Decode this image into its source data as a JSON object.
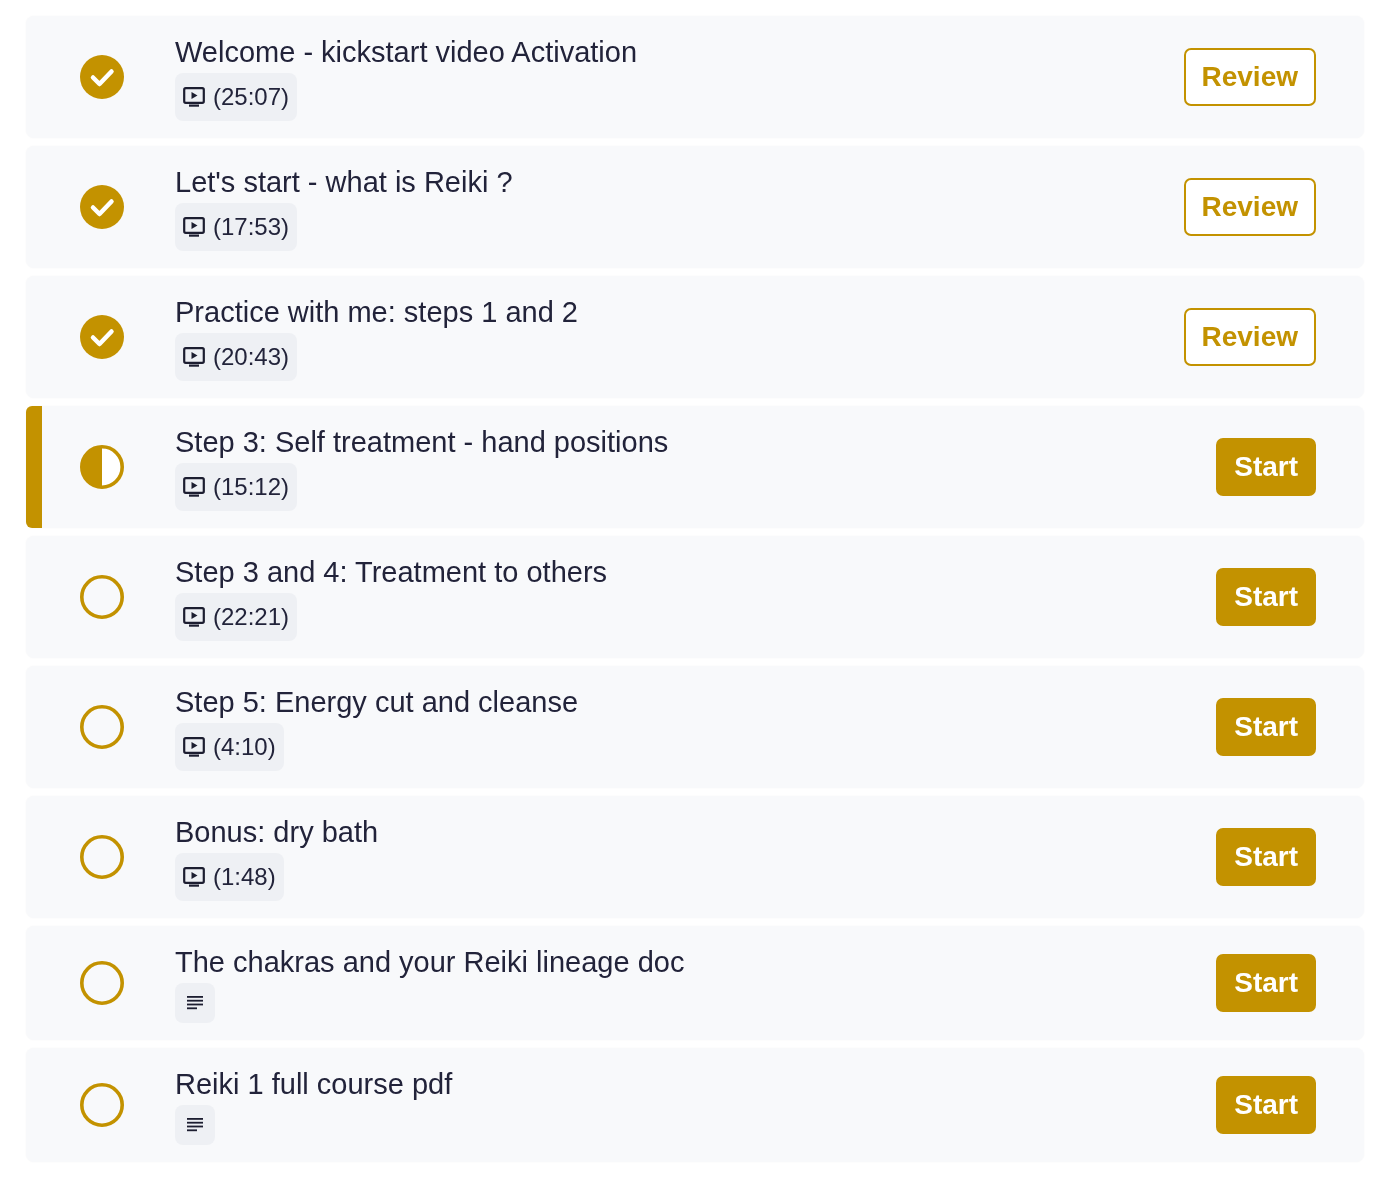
{
  "lessons": [
    {
      "title": "Welcome - kickstart video Activation",
      "kind": "complete",
      "selected": false,
      "media": {
        "kind": "video",
        "duration": "(25:07)"
      },
      "action": {
        "label": "Review",
        "kind": "outline"
      }
    },
    {
      "title": "Let's start - what is Reiki ?",
      "kind": "complete",
      "selected": false,
      "media": {
        "kind": "video",
        "duration": "(17:53)"
      },
      "action": {
        "label": "Review",
        "kind": "outline"
      }
    },
    {
      "title": "Practice with me: steps 1 and 2",
      "kind": "complete",
      "selected": false,
      "media": {
        "kind": "video",
        "duration": "(20:43)"
      },
      "action": {
        "label": "Review",
        "kind": "outline"
      }
    },
    {
      "title": "Step 3: Self treatment - hand positions",
      "kind": "partial",
      "selected": true,
      "media": {
        "kind": "video",
        "duration": "(15:12)"
      },
      "action": {
        "label": "Start",
        "kind": "filled"
      }
    },
    {
      "title": "Step 3 and 4: Treatment to others",
      "kind": "unstarted",
      "selected": false,
      "media": {
        "kind": "video",
        "duration": "(22:21)"
      },
      "action": {
        "label": "Start",
        "kind": "filled"
      }
    },
    {
      "title": "Step 5: Energy cut and cleanse",
      "kind": "unstarted",
      "selected": false,
      "media": {
        "kind": "video",
        "duration": "(4:10)"
      },
      "action": {
        "label": "Start",
        "kind": "filled"
      }
    },
    {
      "title": "Bonus: dry bath",
      "kind": "unstarted",
      "selected": false,
      "media": {
        "kind": "video",
        "duration": "(1:48)"
      },
      "action": {
        "label": "Start",
        "kind": "filled"
      }
    },
    {
      "title": "The chakras and your Reiki lineage doc",
      "kind": "unstarted",
      "selected": false,
      "media": {
        "kind": "document"
      },
      "action": {
        "label": "Start",
        "kind": "filled"
      }
    },
    {
      "title": "Reiki 1 full course pdf",
      "kind": "unstarted",
      "selected": false,
      "media": {
        "kind": "document"
      },
      "action": {
        "label": "Start",
        "kind": "filled"
      }
    }
  ]
}
